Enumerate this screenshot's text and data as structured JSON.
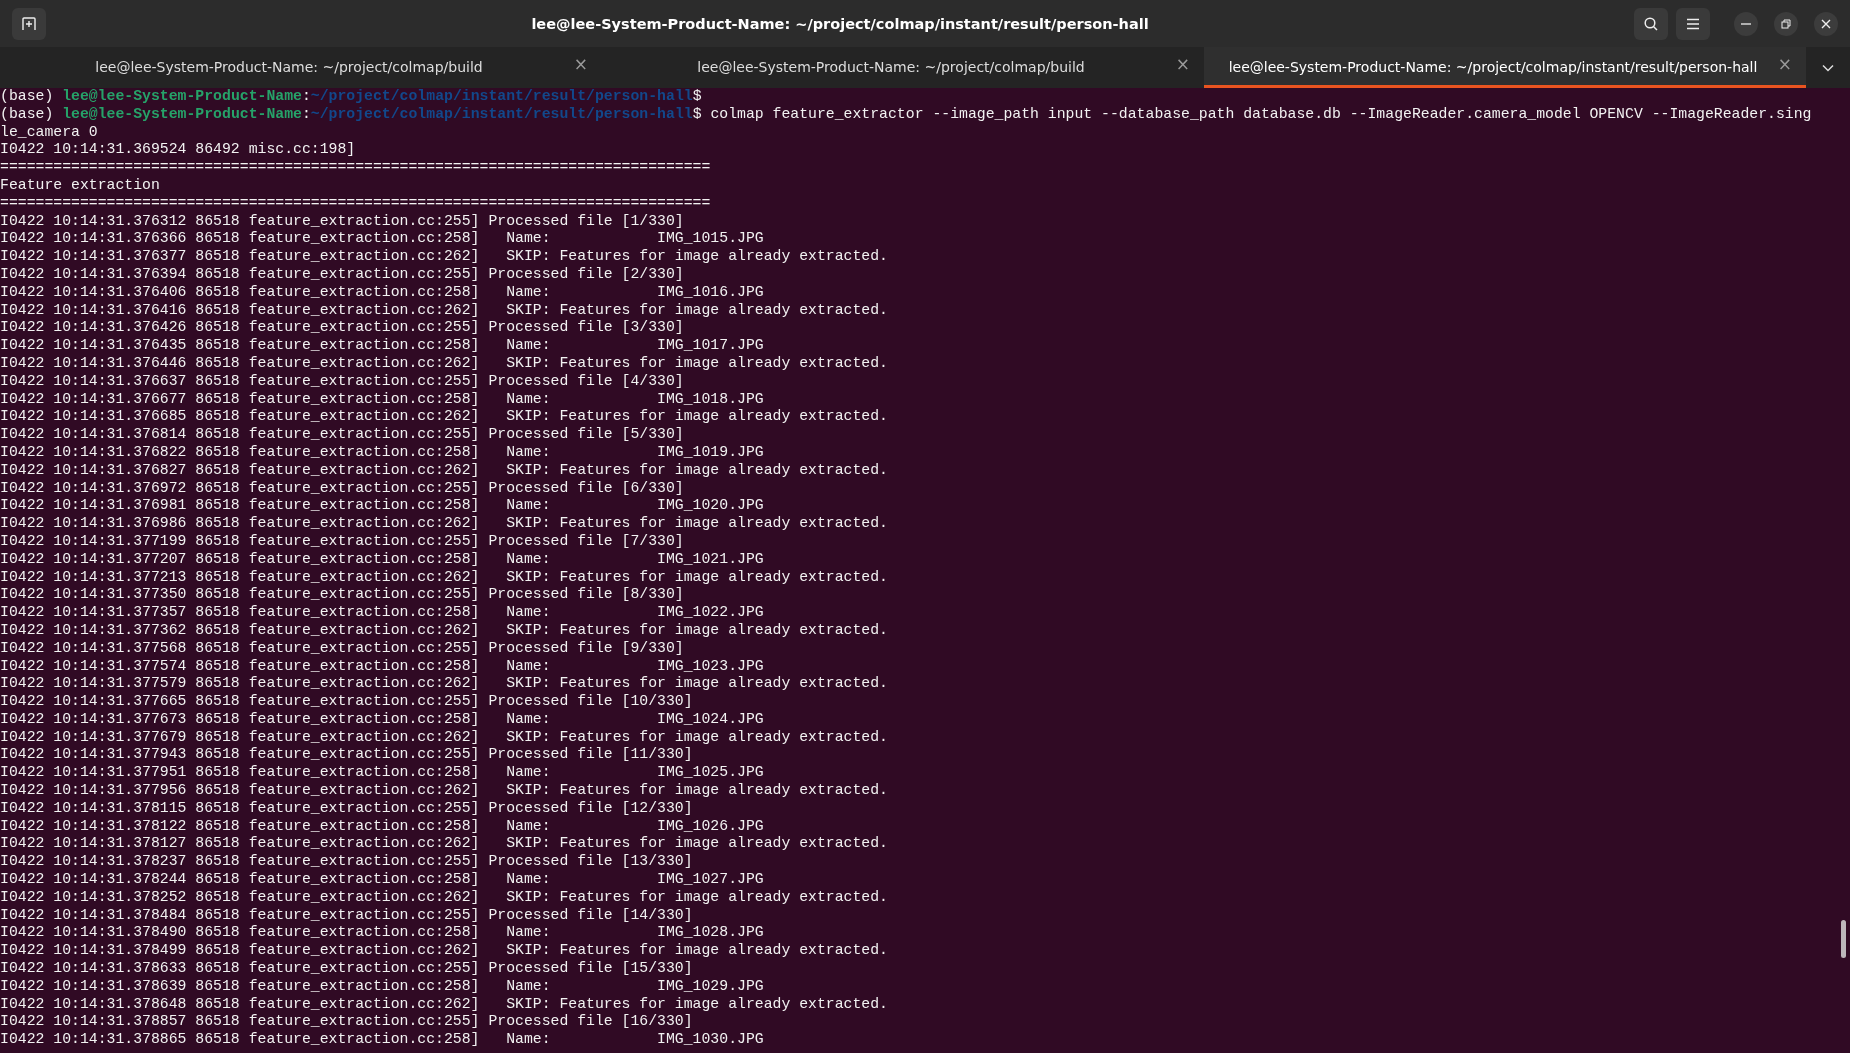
{
  "window": {
    "title": "lee@lee-System-Product-Name: ~/project/colmap/instant/result/person-hall"
  },
  "tabs": [
    {
      "label": "lee@lee-System-Product-Name: ~/project/colmap/build",
      "close": "×",
      "selected": false
    },
    {
      "label": "lee@lee-System-Product-Name: ~/project/colmap/build",
      "close": "×",
      "selected": false
    },
    {
      "label": "lee@lee-System-Product-Name: ~/project/colmap/instant/result/person-hall",
      "close": "×",
      "selected": true
    }
  ],
  "terminal": {
    "lines": [
      {
        "kind": "prompt",
        "env": "(base)",
        "user": "lee@lee-System-Product-Name",
        "separator": ":",
        "path": "~/project/colmap/instant/result/person-hall",
        "symbol": "$"
      },
      {
        "kind": "prompt",
        "env": "(base)",
        "user": "lee@lee-System-Product-Name",
        "separator": ":",
        "path": "~/project/colmap/instant/result/person-hall",
        "symbol": "$",
        "command": "colmap feature_extractor --image_path input --database_path database.db --ImageReader.camera_model OPENCV --ImageReader.single_camera 0"
      },
      {
        "kind": "output",
        "text": "I0422 10:14:31.369524 86492 misc.cc:198]"
      },
      {
        "kind": "output",
        "text": "================================================================================"
      },
      {
        "kind": "output",
        "text": "Feature extraction"
      },
      {
        "kind": "output",
        "text": "================================================================================"
      },
      {
        "kind": "output",
        "text": "I0422 10:14:31.376312 86518 feature_extraction.cc:255] Processed file [1/330]"
      },
      {
        "kind": "output",
        "text": "I0422 10:14:31.376366 86518 feature_extraction.cc:258]   Name:            IMG_1015.JPG"
      },
      {
        "kind": "output",
        "text": "I0422 10:14:31.376377 86518 feature_extraction.cc:262]   SKIP: Features for image already extracted."
      },
      {
        "kind": "output",
        "text": "I0422 10:14:31.376394 86518 feature_extraction.cc:255] Processed file [2/330]"
      },
      {
        "kind": "output",
        "text": "I0422 10:14:31.376406 86518 feature_extraction.cc:258]   Name:            IMG_1016.JPG"
      },
      {
        "kind": "output",
        "text": "I0422 10:14:31.376416 86518 feature_extraction.cc:262]   SKIP: Features for image already extracted."
      },
      {
        "kind": "output",
        "text": "I0422 10:14:31.376426 86518 feature_extraction.cc:255] Processed file [3/330]"
      },
      {
        "kind": "output",
        "text": "I0422 10:14:31.376435 86518 feature_extraction.cc:258]   Name:            IMG_1017.JPG"
      },
      {
        "kind": "output",
        "text": "I0422 10:14:31.376446 86518 feature_extraction.cc:262]   SKIP: Features for image already extracted."
      },
      {
        "kind": "output",
        "text": "I0422 10:14:31.376637 86518 feature_extraction.cc:255] Processed file [4/330]"
      },
      {
        "kind": "output",
        "text": "I0422 10:14:31.376677 86518 feature_extraction.cc:258]   Name:            IMG_1018.JPG"
      },
      {
        "kind": "output",
        "text": "I0422 10:14:31.376685 86518 feature_extraction.cc:262]   SKIP: Features for image already extracted."
      },
      {
        "kind": "output",
        "text": "I0422 10:14:31.376814 86518 feature_extraction.cc:255] Processed file [5/330]"
      },
      {
        "kind": "output",
        "text": "I0422 10:14:31.376822 86518 feature_extraction.cc:258]   Name:            IMG_1019.JPG"
      },
      {
        "kind": "output",
        "text": "I0422 10:14:31.376827 86518 feature_extraction.cc:262]   SKIP: Features for image already extracted."
      },
      {
        "kind": "output",
        "text": "I0422 10:14:31.376972 86518 feature_extraction.cc:255] Processed file [6/330]"
      },
      {
        "kind": "output",
        "text": "I0422 10:14:31.376981 86518 feature_extraction.cc:258]   Name:            IMG_1020.JPG"
      },
      {
        "kind": "output",
        "text": "I0422 10:14:31.376986 86518 feature_extraction.cc:262]   SKIP: Features for image already extracted."
      },
      {
        "kind": "output",
        "text": "I0422 10:14:31.377199 86518 feature_extraction.cc:255] Processed file [7/330]"
      },
      {
        "kind": "output",
        "text": "I0422 10:14:31.377207 86518 feature_extraction.cc:258]   Name:            IMG_1021.JPG"
      },
      {
        "kind": "output",
        "text": "I0422 10:14:31.377213 86518 feature_extraction.cc:262]   SKIP: Features for image already extracted."
      },
      {
        "kind": "output",
        "text": "I0422 10:14:31.377350 86518 feature_extraction.cc:255] Processed file [8/330]"
      },
      {
        "kind": "output",
        "text": "I0422 10:14:31.377357 86518 feature_extraction.cc:258]   Name:            IMG_1022.JPG"
      },
      {
        "kind": "output",
        "text": "I0422 10:14:31.377362 86518 feature_extraction.cc:262]   SKIP: Features for image already extracted."
      },
      {
        "kind": "output",
        "text": "I0422 10:14:31.377568 86518 feature_extraction.cc:255] Processed file [9/330]"
      },
      {
        "kind": "output",
        "text": "I0422 10:14:31.377574 86518 feature_extraction.cc:258]   Name:            IMG_1023.JPG"
      },
      {
        "kind": "output",
        "text": "I0422 10:14:31.377579 86518 feature_extraction.cc:262]   SKIP: Features for image already extracted."
      },
      {
        "kind": "output",
        "text": "I0422 10:14:31.377665 86518 feature_extraction.cc:255] Processed file [10/330]"
      },
      {
        "kind": "output",
        "text": "I0422 10:14:31.377673 86518 feature_extraction.cc:258]   Name:            IMG_1024.JPG"
      },
      {
        "kind": "output",
        "text": "I0422 10:14:31.377679 86518 feature_extraction.cc:262]   SKIP: Features for image already extracted."
      },
      {
        "kind": "output",
        "text": "I0422 10:14:31.377943 86518 feature_extraction.cc:255] Processed file [11/330]"
      },
      {
        "kind": "output",
        "text": "I0422 10:14:31.377951 86518 feature_extraction.cc:258]   Name:            IMG_1025.JPG"
      },
      {
        "kind": "output",
        "text": "I0422 10:14:31.377956 86518 feature_extraction.cc:262]   SKIP: Features for image already extracted."
      },
      {
        "kind": "output",
        "text": "I0422 10:14:31.378115 86518 feature_extraction.cc:255] Processed file [12/330]"
      },
      {
        "kind": "output",
        "text": "I0422 10:14:31.378122 86518 feature_extraction.cc:258]   Name:            IMG_1026.JPG"
      },
      {
        "kind": "output",
        "text": "I0422 10:14:31.378127 86518 feature_extraction.cc:262]   SKIP: Features for image already extracted."
      },
      {
        "kind": "output",
        "text": "I0422 10:14:31.378237 86518 feature_extraction.cc:255] Processed file [13/330]"
      },
      {
        "kind": "output",
        "text": "I0422 10:14:31.378244 86518 feature_extraction.cc:258]   Name:            IMG_1027.JPG"
      },
      {
        "kind": "output",
        "text": "I0422 10:14:31.378252 86518 feature_extraction.cc:262]   SKIP: Features for image already extracted."
      },
      {
        "kind": "output",
        "text": "I0422 10:14:31.378484 86518 feature_extraction.cc:255] Processed file [14/330]"
      },
      {
        "kind": "output",
        "text": "I0422 10:14:31.378490 86518 feature_extraction.cc:258]   Name:            IMG_1028.JPG"
      },
      {
        "kind": "output",
        "text": "I0422 10:14:31.378499 86518 feature_extraction.cc:262]   SKIP: Features for image already extracted."
      },
      {
        "kind": "output",
        "text": "I0422 10:14:31.378633 86518 feature_extraction.cc:255] Processed file [15/330]"
      },
      {
        "kind": "output",
        "text": "I0422 10:14:31.378639 86518 feature_extraction.cc:258]   Name:            IMG_1029.JPG"
      },
      {
        "kind": "output",
        "text": "I0422 10:14:31.378648 86518 feature_extraction.cc:262]   SKIP: Features for image already extracted."
      },
      {
        "kind": "output",
        "text": "I0422 10:14:31.378857 86518 feature_extraction.cc:255] Processed file [16/330]"
      },
      {
        "kind": "output",
        "text": "I0422 10:14:31.378865 86518 feature_extraction.cc:258]   Name:            IMG_1030.JPG"
      }
    ]
  }
}
